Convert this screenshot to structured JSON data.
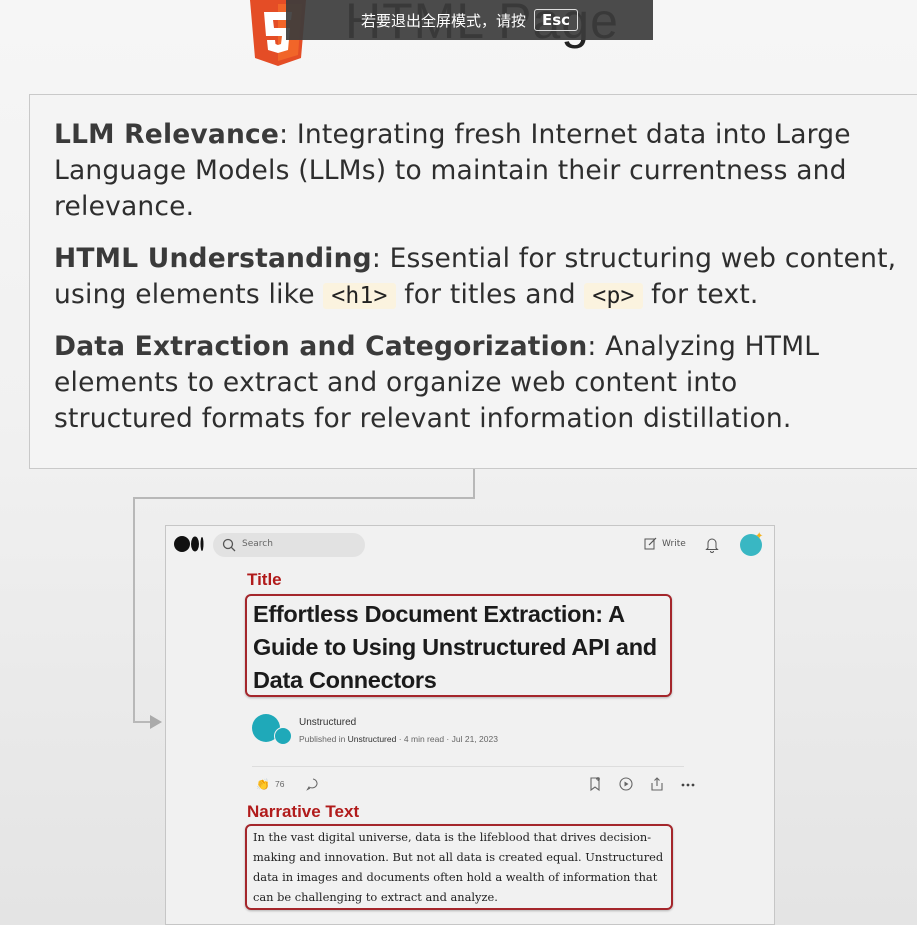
{
  "background_title": "HTML Page",
  "fullscreen_banner": {
    "text": "若要退出全屏模式，请按",
    "key": "Esc"
  },
  "info": {
    "items": [
      {
        "term": "LLM Relevance",
        "lines": [
          ": Integrating fresh Internet data into Large",
          "Language Models (LLMs) to maintain their currentness and",
          "relevance."
        ]
      },
      {
        "term": "HTML Understanding",
        "line1": ": Essential for structuring web content,",
        "line2_prefix": "using elements like ",
        "code1": "<h1>",
        "line2_middle": " for titles and ",
        "code2": "<p>",
        "line2_suffix": " for text."
      },
      {
        "term": "Data Extraction and Categorization",
        "lines": [
          ": Analyzing HTML",
          "elements to extract and organize web content into",
          "structured formats for relevant information distillation."
        ]
      }
    ]
  },
  "medium": {
    "search_placeholder": "Search",
    "write_label": "Write",
    "title_label": "Title",
    "article_title": "Effortless Document Extraction: A Guide to Using Unstructured API and Data Connectors",
    "publisher_name": "Unstructured",
    "published_in_prefix": "Published in ",
    "published_in": "Unstructured",
    "read_time": " · 4 min read · ",
    "date": "Jul 21, 2023",
    "claps": "76",
    "narrative_label": "Narrative Text",
    "narrative_text": "In the vast digital universe, data is the lifeblood that drives decision-making and innovation. But not all data is created equal. Unstructured data in images and documents often hold a wealth of information that can be challenging to extract and analyze."
  },
  "colors": {
    "html5": "#e44d26",
    "highlight_red": "#a4262b",
    "code_bg": "#fbf3df"
  }
}
